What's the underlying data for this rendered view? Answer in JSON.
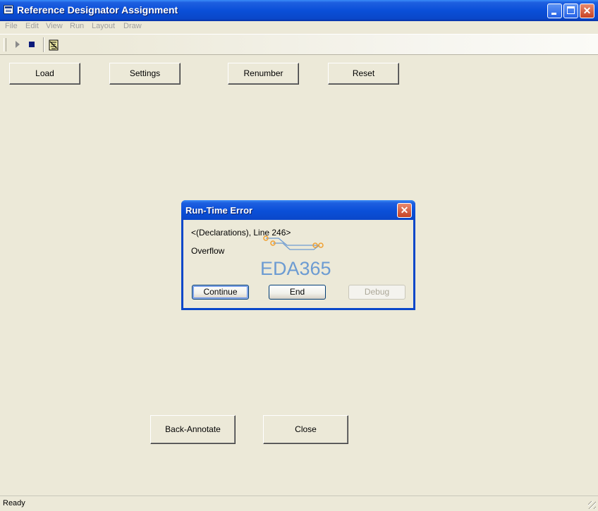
{
  "window": {
    "title": "Reference Designator Assignment"
  },
  "menu": [
    "File",
    "Edit",
    "View",
    "Run",
    "Layout",
    "Draw"
  ],
  "toolbar": {
    "icons": [
      "run-icon",
      "stop-icon",
      "edit-script-icon"
    ]
  },
  "buttons": {
    "load": "Load",
    "settings": "Settings",
    "renumber": "Renumber",
    "reset": "Reset",
    "back_annotate": "Back-Annotate",
    "close": "Close"
  },
  "dialog": {
    "title": "Run-Time Error",
    "line1": "<(Declarations), Line 246>",
    "line2": "Overflow",
    "continue_label": "Continue",
    "end_label": "End",
    "debug_label": "Debug",
    "watermark_text": "EDA365"
  },
  "status": {
    "text": "Ready"
  },
  "colors": {
    "titlebar": "#0A47C9",
    "face": "#ECE9D8",
    "close_button": "#C74224",
    "watermark_blue": "#6C9BD2",
    "watermark_orange": "#F0A030"
  }
}
